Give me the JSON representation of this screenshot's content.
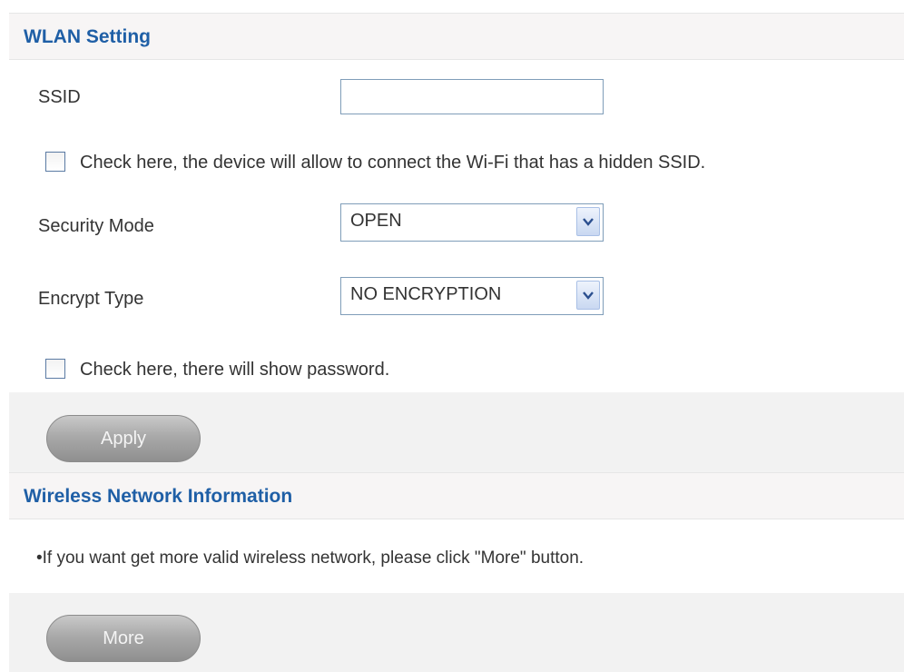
{
  "wlan_section": {
    "title": "WLAN Setting",
    "ssid_label": "SSID",
    "ssid_value": "",
    "hidden_ssid_checkbox_label": "Check here, the device will allow to connect the Wi-Fi that has a hidden SSID.",
    "hidden_ssid_checked": false,
    "security_mode_label": "Security Mode",
    "security_mode_value": "OPEN",
    "encrypt_type_label": "Encrypt Type",
    "encrypt_type_value": "NO ENCRYPTION",
    "show_password_checkbox_label": "Check here, there will show password.",
    "show_password_checked": false,
    "apply_button_label": "Apply"
  },
  "wireless_info_section": {
    "title": "Wireless Network Information",
    "hint_text": "•If you want get more valid wireless network, please click \"More\" button.",
    "more_button_label": "More"
  },
  "colors": {
    "header_title": "#1f5fa6",
    "header_background": "#f7f5f5",
    "band_background": "#f2f2f2",
    "button_gray": "#a9a9a9"
  },
  "icons": {
    "dropdown": "chevron-down-icon"
  }
}
